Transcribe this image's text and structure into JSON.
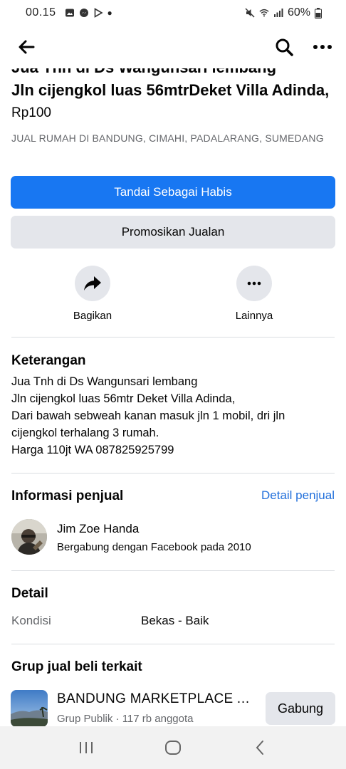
{
  "status_bar": {
    "time": "00.15",
    "battery": "60%"
  },
  "listing": {
    "title_partial": "Jua Tnh di Ds Wangunsari lembang",
    "title": "Jln cijengkol luas 56mtrDeket Villa Adinda,",
    "price": "Rp100",
    "category": "JUAL RUMAH DI BANDUNG, CIMAHI, PADALARANG, SUMEDANG"
  },
  "buttons": {
    "mark_sold": "Tandai Sebagai Habis",
    "promote": "Promosikan Jualan"
  },
  "actions": {
    "share": "Bagikan",
    "more": "Lainnya"
  },
  "description": {
    "heading": "Keterangan",
    "lines": [
      "Jua Tnh di Ds Wangunsari lembang",
      "Jln cijengkol luas 56mtr Deket Villa Adinda,",
      "Dari bawah sebweah kanan masuk jln 1 mobil, dri jln",
      "cijengkol terhalang 3 rumah.",
      "Harga 110jt WA 087825925799"
    ]
  },
  "seller": {
    "heading": "Informasi penjual",
    "link": "Detail penjual",
    "name": "Jim Zoe Handa",
    "joined": "Bergabung dengan Facebook pada 2010"
  },
  "detail": {
    "heading": "Detail",
    "condition_label": "Kondisi",
    "condition_value": "Bekas - Baik"
  },
  "groups": {
    "heading": "Grup jual beli terkait",
    "name": "BANDUNG MARKETPLACE AREA",
    "meta": "Grup Publik · 117 rb anggota",
    "join": "Gabung"
  },
  "colors": {
    "primary": "#1877f2",
    "secondary_bg": "#e4e6eb",
    "link": "#216fdb",
    "muted_text": "#65676b"
  }
}
